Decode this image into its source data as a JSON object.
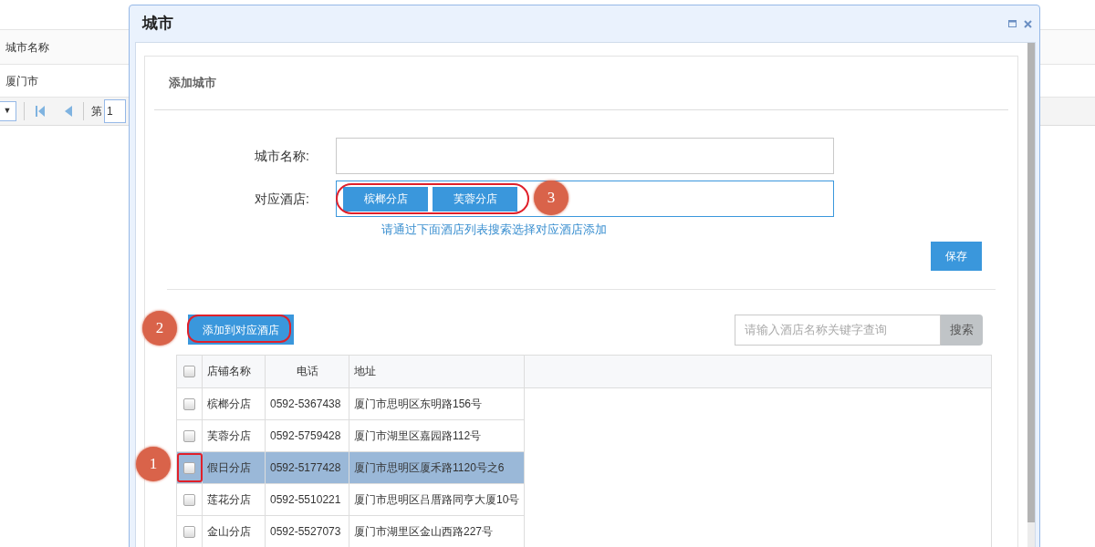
{
  "background_page": {
    "table_header": "城市名称",
    "table_row": "厦门市",
    "pager": {
      "dropdown_arrow": "▼",
      "page_label": "第",
      "page_value": "1"
    }
  },
  "dialog": {
    "title": "城市",
    "section_title": "添加城市",
    "form": {
      "city_name_label": "城市名称:",
      "hotel_label": "对应酒店:",
      "hotel_tags": [
        "槟榔分店",
        "芙蓉分店"
      ],
      "hint": "请通过下面酒店列表搜索选择对应酒店添加",
      "save_button": "保存"
    },
    "add_button": "添加到对应酒店",
    "search": {
      "placeholder": "请输入酒店名称关键字查询",
      "button": "搜索"
    },
    "table": {
      "header_checked": false,
      "columns": [
        "店铺名称",
        "电话",
        "地址"
      ],
      "rows": [
        {
          "name": "槟榔分店",
          "phone": "0592-5367438",
          "address": "厦门市思明区东明路156号",
          "checked": false,
          "selected": false
        },
        {
          "name": "芙蓉分店",
          "phone": "0592-5759428",
          "address": "厦门市湖里区嘉园路112号",
          "checked": false,
          "selected": false
        },
        {
          "name": "假日分店",
          "phone": "0592-5177428",
          "address": "厦门市思明区厦禾路1120号之6",
          "checked": false,
          "selected": true
        },
        {
          "name": "莲花分店",
          "phone": "0592-5510221",
          "address": "厦门市思明区吕厝路同亨大厦10号",
          "checked": false,
          "selected": false
        },
        {
          "name": "金山分店",
          "phone": "0592-5527073",
          "address": "厦门市湖里区金山西路227号",
          "checked": false,
          "selected": false
        }
      ]
    }
  },
  "annotations": [
    "1",
    "2",
    "3"
  ]
}
